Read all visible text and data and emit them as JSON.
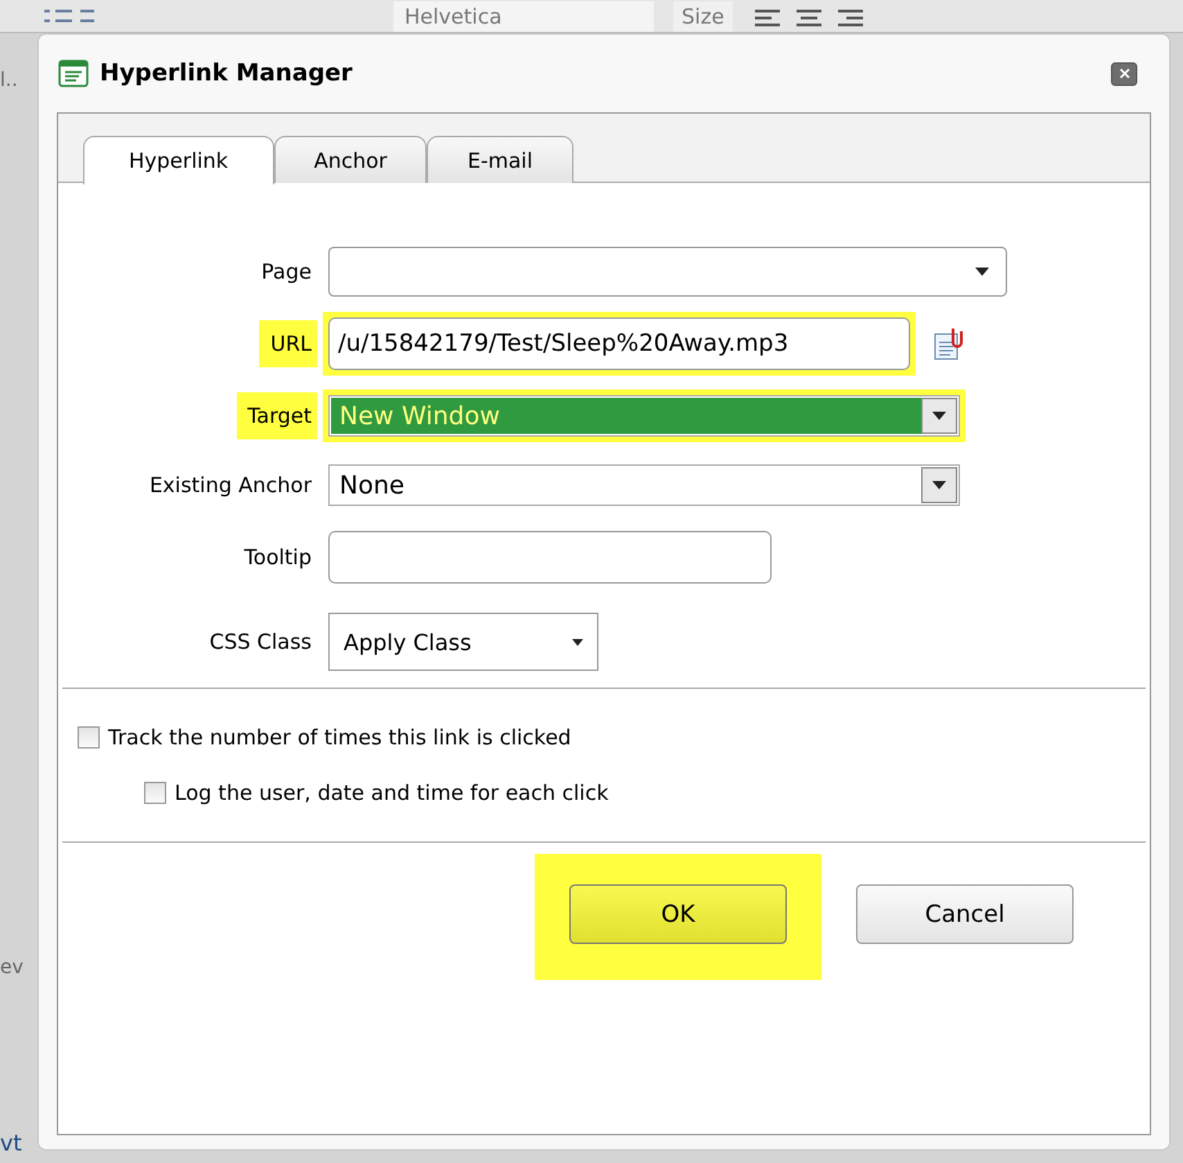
{
  "background": {
    "font_name": "Helvetica",
    "font_size": "Size",
    "left_fragments": [
      "l..",
      "ev",
      "vt"
    ]
  },
  "dialog": {
    "title": "Hyperlink Manager"
  },
  "tabs": [
    {
      "label": "Hyperlink",
      "selected": true
    },
    {
      "label": "Anchor",
      "selected": false
    },
    {
      "label": "E-mail",
      "selected": false
    }
  ],
  "fields": [
    {
      "kind": "dropdown",
      "label": "Page",
      "highlighted": false
    },
    {
      "kind": "text",
      "label": "URL",
      "value": "/u/15842179/Test/Sleep%20Away.mp3",
      "highlighted": true,
      "wide": true
    },
    {
      "kind": "select",
      "label": "Target",
      "value": "New Window",
      "highlighted": true,
      "value_selected": true
    },
    {
      "kind": "select",
      "label": "Existing Anchor",
      "value": "None",
      "highlighted": false,
      "value_selected": false
    },
    {
      "kind": "text",
      "label": "Tooltip",
      "highlighted": false,
      "wide": false
    },
    {
      "kind": "small-dropdown",
      "label": "CSS Class",
      "value": "Apply Class",
      "highlighted": false
    }
  ],
  "checkboxes": [
    {
      "label": "Track the number of times this link is clicked",
      "checked": false,
      "children": [
        {
          "label": "Log the user, date and time for each click",
          "checked": false
        }
      ]
    }
  ],
  "buttons": [
    {
      "label": "OK",
      "highlighted": true
    },
    {
      "label": "Cancel",
      "highlighted": false
    }
  ]
}
